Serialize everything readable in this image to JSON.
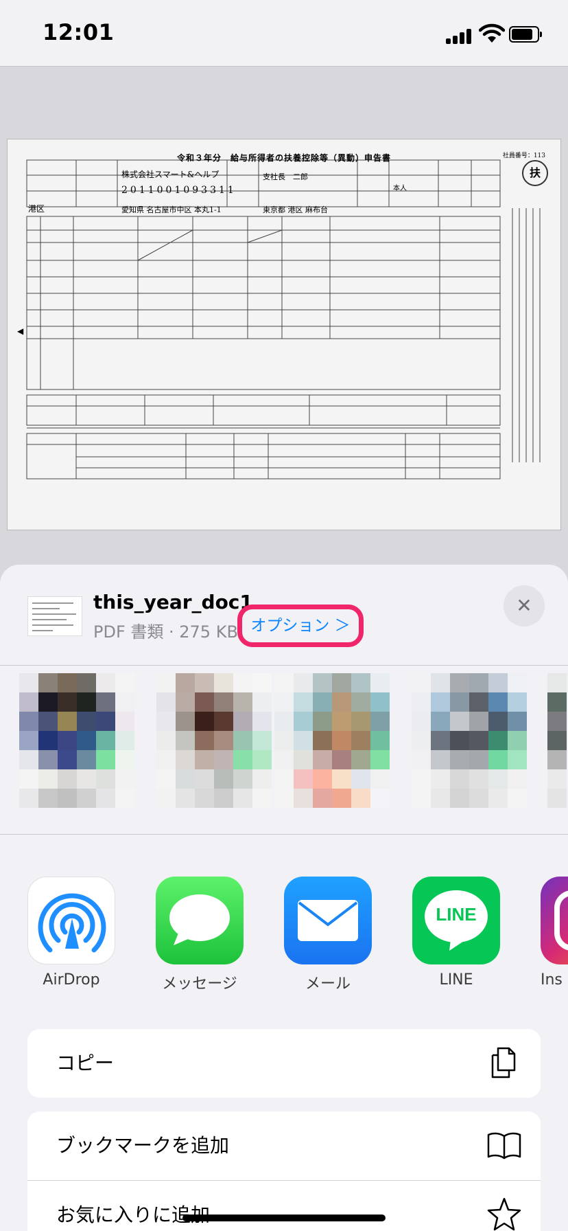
{
  "status_bar": {
    "time": "12:01"
  },
  "document": {
    "title": "令和３年分　給与所得者の扶養控除等（異動）申告書",
    "employee_no": "社員番号：113",
    "seal": "扶",
    "company": "株式会社スマート&ヘルプ",
    "corp_number": "2011001093311",
    "address": "愛知県 名古屋市中区 本丸1-1",
    "ward": "港区",
    "name": "支社長　二郎",
    "city": "東京都 港区 麻布台",
    "relation": "本人"
  },
  "share_sheet": {
    "file_name": "this_year_doc1",
    "file_meta": "PDF 書類 · 275 KB",
    "options_label": "オプション ＞",
    "apps": [
      {
        "label": "AirDrop",
        "icon": "airdrop-icon"
      },
      {
        "label": "メッセージ",
        "icon": "messages-icon"
      },
      {
        "label": "メール",
        "icon": "mail-icon"
      },
      {
        "label": "LINE",
        "icon": "line-icon",
        "icon_text": "LINE"
      },
      {
        "label": "Ins",
        "icon": "instagram-icon"
      }
    ],
    "actions": [
      {
        "label": "コピー",
        "icon": "copy-icon"
      },
      {
        "label": "ブックマークを追加",
        "icon": "book-icon"
      },
      {
        "label": "お気に入りに追加",
        "icon": "star-icon"
      }
    ]
  },
  "colors": {
    "options_highlight": "#f0266a",
    "link_blue": "#0a84ff",
    "sheet_background": "#f2f2f6"
  }
}
